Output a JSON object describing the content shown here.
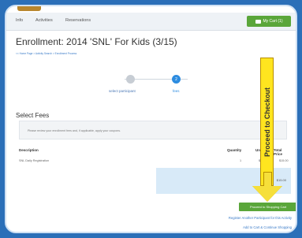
{
  "nav": {
    "items": [
      "Info",
      "Activities",
      "Reservations"
    ],
    "cart_label": "My Cart (1)"
  },
  "page": {
    "title": "Enrollment: 2014 'SNL' For Kids (3/15)",
    "breadcrumb": "<< Home Page > Activity Search > Enrollment Process"
  },
  "steps": [
    {
      "label": "select participant",
      "state": "done"
    },
    {
      "label": "fees",
      "state": "current"
    }
  ],
  "fees": {
    "title": "Select Fees",
    "notice": "Please review your enrollment fees and, if applicable, apply your coupons.",
    "headers": [
      "Description",
      "Quantity",
      "Unit Fee",
      "Total Price"
    ],
    "rows": [
      {
        "description": "SNL Daily Registration",
        "quantity": "1",
        "unit_fee": "$15.00",
        "total": "$15.00"
      }
    ],
    "total": "$15.00"
  },
  "actions": {
    "proceed_label": "Proceed to Shopping Cart",
    "register_another": "Register Another Participant for this Activity",
    "add_continue": "Add to Cart & Continue Shopping"
  },
  "annotation": {
    "label": "Proceed to Checkout"
  },
  "colors": {
    "accent_green": "#5aa63a",
    "brand_blue": "#2d8ce0",
    "callout_yellow": "#ffe51f"
  }
}
